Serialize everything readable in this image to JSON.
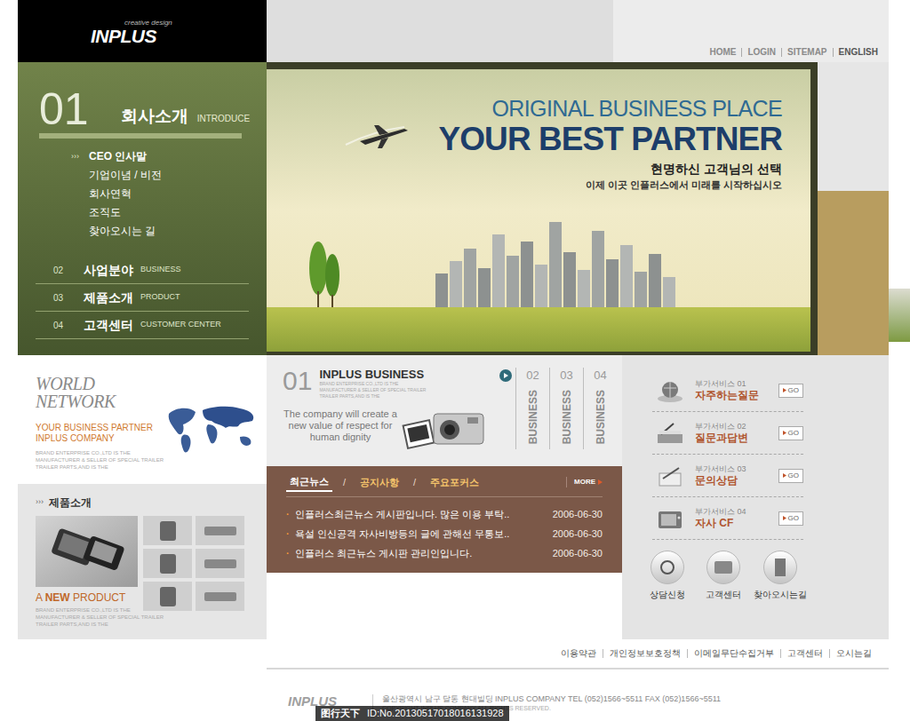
{
  "logo": {
    "name": "INPLUS",
    "tagline": "creative design"
  },
  "top_nav": [
    "HOME",
    "LOGIN",
    "SITEMAP",
    "ENGLISH"
  ],
  "side_menu": {
    "number": "01",
    "title": "회사소개",
    "subtitle": "INTRODUCE",
    "bullet": "›››",
    "items": [
      {
        "label": "CEO 인사말",
        "selected": true
      },
      {
        "label": "기업이념 / 비전",
        "selected": false
      },
      {
        "label": "회사연혁",
        "selected": false
      },
      {
        "label": "조직도",
        "selected": false
      },
      {
        "label": "찾아오시는 길",
        "selected": false
      }
    ]
  },
  "main_menu": [
    {
      "number": "02",
      "title": "사업분야",
      "subtitle": "BUSINESS"
    },
    {
      "number": "03",
      "title": "제품소개",
      "subtitle": "PRODUCT"
    },
    {
      "number": "04",
      "title": "고객센터",
      "subtitle": "CUSTOMER CENTER"
    }
  ],
  "hero": {
    "line1": "ORIGINAL BUSINESS PLACE",
    "line2": "YOUR BEST PARTNER",
    "line3": "현명하신 고객님의 선택",
    "line4": "이제 이곳 인플러스에서 미래를 시작하십시오"
  },
  "world_network": {
    "title": "WORLD NETWORK",
    "line1": "YOUR BUSINESS PARTNER",
    "line2": "INPLUS COMPANY",
    "desc": [
      "BRAND ENTERPRISE CO.,LTD IS THE",
      "MANUFACTURER & SELLER OF SPECIAL TRAILER",
      "TRAILER PARTS,AND IS THE"
    ]
  },
  "products": {
    "bullet": "›››",
    "title": "제품소개",
    "new_label": [
      "A",
      "NEW",
      "PRODUCT"
    ],
    "desc": [
      "BRAND ENTERPRISE CO.,LTD IS THE",
      "MANUFACTURER & SELLER OF SPECIAL TRAILER",
      "TRAILER PARTS,AND IS THE"
    ]
  },
  "business": {
    "number": "01",
    "title": "INPLUS BUSINESS",
    "desc": [
      "BRAND ENTERPRISE CO.,LTD IS THE",
      "MANUFACTURER & SELLER OF SPECIAL TRAILER",
      "TRAILER PARTS,AND IS THE"
    ],
    "tagline": "The company will create a new value of respect for human dignity",
    "tabs": [
      {
        "number": "02",
        "label": "BUSINESS"
      },
      {
        "number": "03",
        "label": "BUSINESS"
      },
      {
        "number": "04",
        "label": "BUSINESS"
      }
    ]
  },
  "news": {
    "tabs": [
      {
        "label": "최근뉴스",
        "selected": true
      },
      {
        "label": "공지사항",
        "selected": false
      },
      {
        "label": "주요포커스",
        "selected": false
      }
    ],
    "separator": "/",
    "more": "MORE",
    "bullet": "·",
    "rows": [
      {
        "title": "인플러스최근뉴스 게시판입니다. 많은 이용 부탁..",
        "date": "2006-06-30"
      },
      {
        "title": "욕설 인신공격 자사비방등의 글에 관해선 무통보..",
        "date": "2006-06-30"
      },
      {
        "title": "인플러스 최근뉴스 게시판 관리인입니다.",
        "date": "2006-06-30"
      }
    ]
  },
  "services": [
    {
      "label": "부가서비스 01",
      "title": "자주하는질문",
      "button": "GO"
    },
    {
      "label": "부가서비스 02",
      "title": "질문과답변",
      "button": "GO"
    },
    {
      "label": "부가서비스 03",
      "title": "문의상담",
      "button": "GO"
    },
    {
      "label": "부가서비스 04",
      "title": "자사 CF",
      "button": "GO"
    }
  ],
  "quick_links": [
    "상담신청",
    "고객센터",
    "찾아오시는길"
  ],
  "footer": {
    "links": [
      "이용약관",
      "개인정보보호정책",
      "이메일무단수집거부",
      "고객센터",
      "오시는길"
    ],
    "logo": "INPLUS",
    "address": "울산광역시 남구 달동 현대빌딩  INPLUS COMPANY   TEL (052)1566~5511  FAX (052)1566~5511",
    "copyright": "COPYRIGHT INPLUS COMPANY ALL RIGHTS RESERVED."
  },
  "watermark": {
    "site": "图行天下",
    "id": "ID:No.20130517018016131928"
  }
}
